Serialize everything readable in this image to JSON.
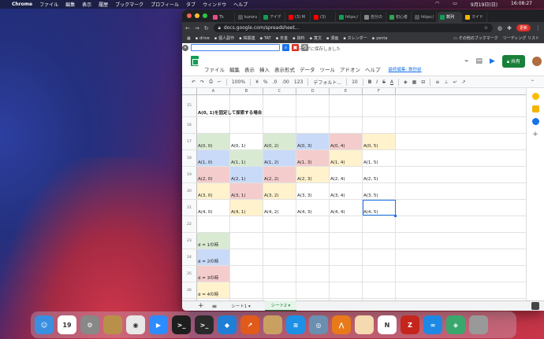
{
  "menubar": {
    "app": "Chrome",
    "items": [
      "ファイル",
      "編集",
      "表示",
      "履歴",
      "ブックマーク",
      "プロフィール",
      "タブ",
      "ウィンドウ",
      "ヘルプ"
    ],
    "date": "9月19日(日)",
    "time": "16:08:27"
  },
  "tabs": [
    {
      "label": "Tk",
      "color": "#e94b8a"
    },
    {
      "label": "kuroru",
      "color": "#555"
    },
    {
      "label": "アイデ",
      "color": "#0f9d58"
    },
    {
      "label": "(3) M",
      "color": "#ff0000"
    },
    {
      "label": "(3) ",
      "color": "#ff0000"
    },
    {
      "label": "https:/",
      "color": "#0f9d58"
    },
    {
      "label": "自分の",
      "color": "#888"
    },
    {
      "label": "初心者",
      "color": "#2ea44f"
    },
    {
      "label": "https:/",
      "color": "#555"
    },
    {
      "label": "数列",
      "color": "#0f9d58"
    },
    {
      "label": "マイド",
      "color": "#f4b400"
    }
  ],
  "url": "docs.google.com/spreadsheet...",
  "update_label": "更新",
  "bookmarks": [
    "drive",
    "個人副作",
    "株関連",
    "TAT",
    "年金",
    "資料",
    "寛文",
    "漫画",
    "カレンダー",
    "yenta"
  ],
  "bookmarks_right": [
    "その他のブックマーク",
    "リーディング リスト"
  ],
  "saved_msg": "ライブに保存しました",
  "menus": [
    "ファイル",
    "編集",
    "表示",
    "挿入",
    "表示形式",
    "データ",
    "ツール",
    "アドオン",
    "ヘルプ"
  ],
  "last_edit": "最終編集: 数秒前",
  "share": "共有",
  "toolbar": {
    "zoom": "100%",
    "currency": "¥",
    "percent": "%",
    "dec0": ".0",
    "dec00": ".00",
    "fmt": "123",
    "font": "デフォルト...",
    "size": "10"
  },
  "columns": [
    "A",
    "B",
    "C",
    "D",
    "E",
    "F"
  ],
  "rows": [
    {
      "n": "15",
      "h": 28,
      "cells": [
        "A(0, 1)を固定して探索する場合",
        "",
        "",
        "",
        "",
        ""
      ],
      "bold": true
    },
    {
      "n": "16",
      "h": 21,
      "cells": [
        "",
        "",
        "",
        "",
        "",
        ""
      ]
    },
    {
      "n": "17",
      "h": 21,
      "cells": [
        "A(0, 0)",
        "A(0, 1)",
        "A(0, 2)",
        "A(0, 3)",
        "A(0, 4)",
        "A(0, 5)"
      ],
      "bg": [
        "#d9ead3",
        "",
        "#d9ead3",
        "#c9daf8",
        "#f4cccc",
        "#fff2cc"
      ]
    },
    {
      "n": "18",
      "h": 21,
      "cells": [
        "A(1, 0)",
        "A(1, 1)",
        "A(1, 2)",
        "A(1, 3)",
        "A(1, 4)",
        "A(1, 5)"
      ],
      "bg": [
        "#c9daf8",
        "#d9ead3",
        "#c9daf8",
        "#f4cccc",
        "#fff2cc",
        ""
      ]
    },
    {
      "n": "19",
      "h": 21,
      "cells": [
        "A(2, 0)",
        "A(2, 1)",
        "A(2, 2)",
        "A(2, 3)",
        "A(2, 4)",
        "A(2, 5)"
      ],
      "bg": [
        "#f4cccc",
        "#c9daf8",
        "#f4cccc",
        "#fff2cc",
        "",
        ""
      ]
    },
    {
      "n": "20",
      "h": 21,
      "cells": [
        "A(3, 0)",
        "A(3, 1)",
        "A(3, 2)",
        "A(3, 3)",
        "A(3, 4)",
        "A(3, 5)"
      ],
      "bg": [
        "#fff2cc",
        "#f4cccc",
        "#fff2cc",
        "",
        "",
        ""
      ]
    },
    {
      "n": "21",
      "h": 21,
      "cells": [
        "A(4, 0)",
        "A(4, 1)",
        "A(4, 2)",
        "A(4, 3)",
        "A(4, 4)",
        "A(4, 5)"
      ],
      "bg": [
        "",
        "#fff2cc",
        "",
        "",
        "",
        ""
      ],
      "sel": 5
    },
    {
      "n": "22",
      "h": 21,
      "cells": [
        "",
        "",
        "",
        "",
        "",
        ""
      ]
    },
    {
      "n": "23",
      "h": 21,
      "cells": [
        "d = 1の時",
        "",
        "",
        "",
        "",
        ""
      ],
      "bg": [
        "#d9ead3",
        "",
        "",
        "",
        "",
        ""
      ]
    },
    {
      "n": "24",
      "h": 21,
      "cells": [
        "d = 2の時",
        "",
        "",
        "",
        "",
        ""
      ],
      "bg": [
        "#c9daf8",
        "",
        "",
        "",
        "",
        ""
      ]
    },
    {
      "n": "25",
      "h": 21,
      "cells": [
        "d = 3の時",
        "",
        "",
        "",
        "",
        ""
      ],
      "bg": [
        "#f4cccc",
        "",
        "",
        "",
        "",
        ""
      ]
    },
    {
      "n": "26",
      "h": 21,
      "cells": [
        "d = 4の時",
        "",
        "",
        "",
        "",
        ""
      ],
      "bg": [
        "#fff2cc",
        "",
        "",
        "",
        "",
        ""
      ]
    },
    {
      "n": "27",
      "h": 12,
      "cells": [
        "",
        "",
        "",
        "",
        "",
        ""
      ]
    }
  ],
  "sheet_tabs": [
    "シート1",
    "シート2"
  ],
  "dock_apps": [
    {
      "name": "finder",
      "color": "#3b8fe0",
      "label": "☺"
    },
    {
      "name": "calendar",
      "color": "#fff",
      "label": "19"
    },
    {
      "name": "system-preferences",
      "color": "#888",
      "label": "⚙"
    },
    {
      "name": "archive",
      "color": "#b8904a",
      "label": ""
    },
    {
      "name": "chrome",
      "color": "#e8e8e8",
      "label": "◉"
    },
    {
      "name": "zoom",
      "color": "#2d8cff",
      "label": "▶"
    },
    {
      "name": "terminal-green",
      "color": "#1e1e1e",
      "label": ">_"
    },
    {
      "name": "terminal",
      "color": "#2a2a2a",
      "label": ">_"
    },
    {
      "name": "vscode",
      "color": "#1f7fd6",
      "label": "◆"
    },
    {
      "name": "monitor",
      "color": "#e05a1a",
      "label": "↗"
    },
    {
      "name": "package",
      "color": "#c8a060",
      "label": ""
    },
    {
      "name": "docker",
      "color": "#1d91e6",
      "label": "≋"
    },
    {
      "name": "screenshot",
      "color": "#6b8fb0",
      "label": "◎"
    },
    {
      "name": "sourcetree",
      "color": "#e87a1a",
      "label": "⋀"
    },
    {
      "name": "preview",
      "color": "#f5d9b0",
      "label": ""
    },
    {
      "name": "notion",
      "color": "#fff",
      "label": "N"
    },
    {
      "name": "filezilla",
      "color": "#c4261d",
      "label": "Z"
    },
    {
      "name": "infinity",
      "color": "#1e88e5",
      "label": "∞"
    },
    {
      "name": "app-diamond",
      "color": "#3aa76d",
      "label": "◈"
    },
    {
      "name": "trash",
      "color": "#999",
      "label": ""
    }
  ]
}
